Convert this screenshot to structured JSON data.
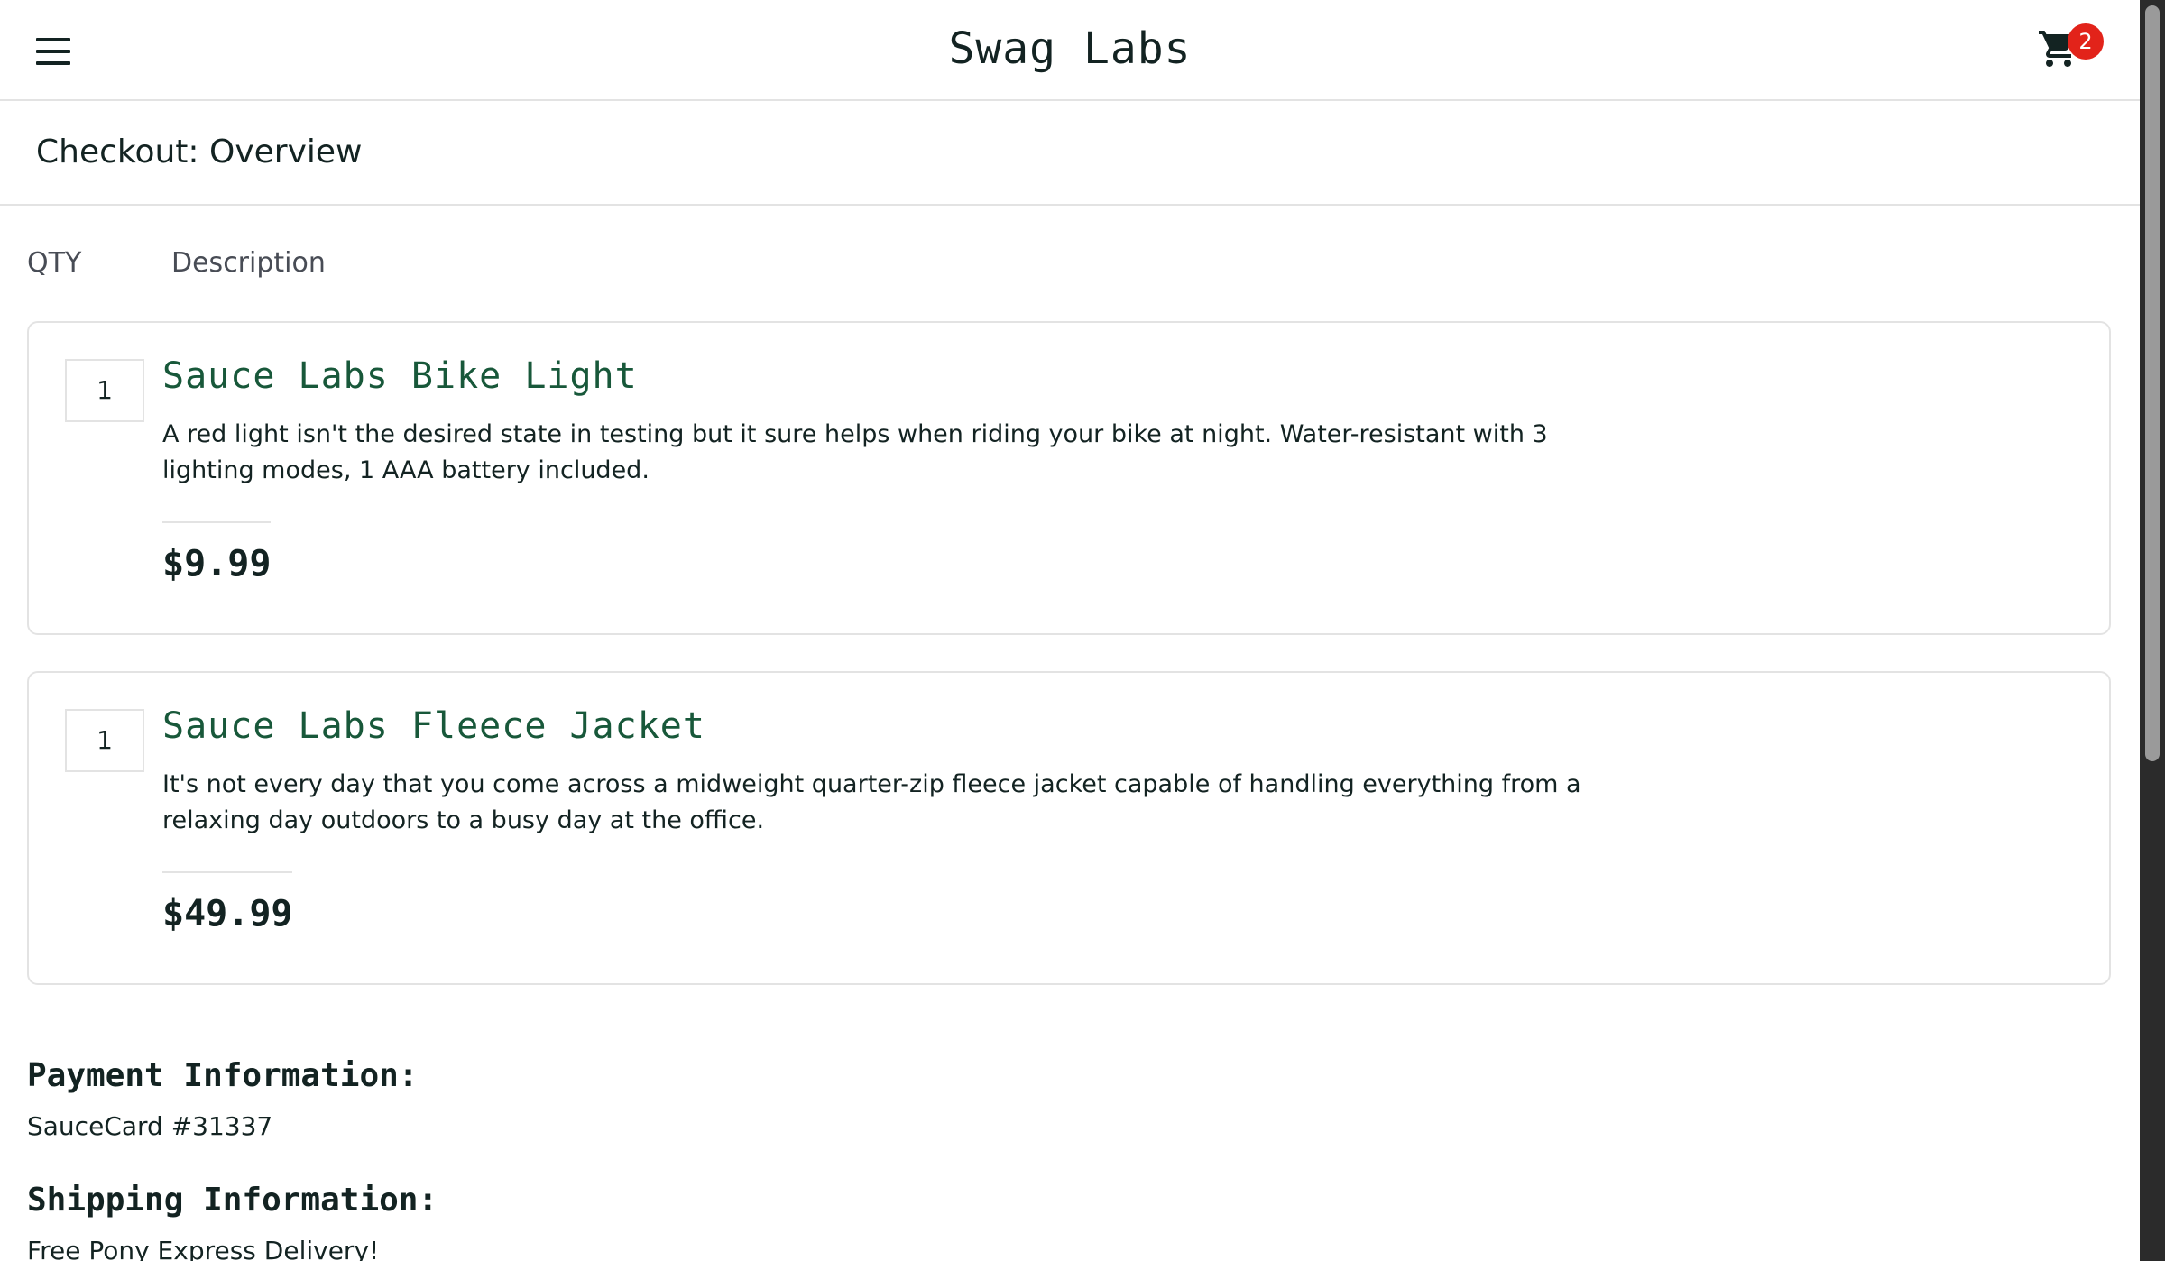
{
  "header": {
    "app_title": "Swag Labs",
    "cart_count": "2"
  },
  "sub_header": {
    "title": "Checkout: Overview"
  },
  "columns": {
    "qty": "QTY",
    "description": "Description"
  },
  "items": [
    {
      "qty": "1",
      "name": "Sauce Labs Bike Light",
      "description": "A red light isn't the desired state in testing but it sure helps when riding your bike at night. Water-resistant with 3 lighting modes, 1 AAA battery included.",
      "price": "$9.99"
    },
    {
      "qty": "1",
      "name": "Sauce Labs Fleece Jacket",
      "description": "It's not every day that you come across a midweight quarter-zip fleece jacket capable of handling everything from a relaxing day outdoors to a busy day at the office.",
      "price": "$49.99"
    }
  ],
  "summary": {
    "payment_label": "Payment Information:",
    "payment_value": "SauceCard #31337",
    "shipping_label": "Shipping Information:",
    "shipping_value": "Free Pony Express Delivery!"
  },
  "icons": {
    "menu": "hamburger-menu-icon",
    "cart": "shopping-cart-icon"
  },
  "colors": {
    "item_name": "#18583a",
    "badge": "#e2231a",
    "border": "#e3e3e3"
  }
}
